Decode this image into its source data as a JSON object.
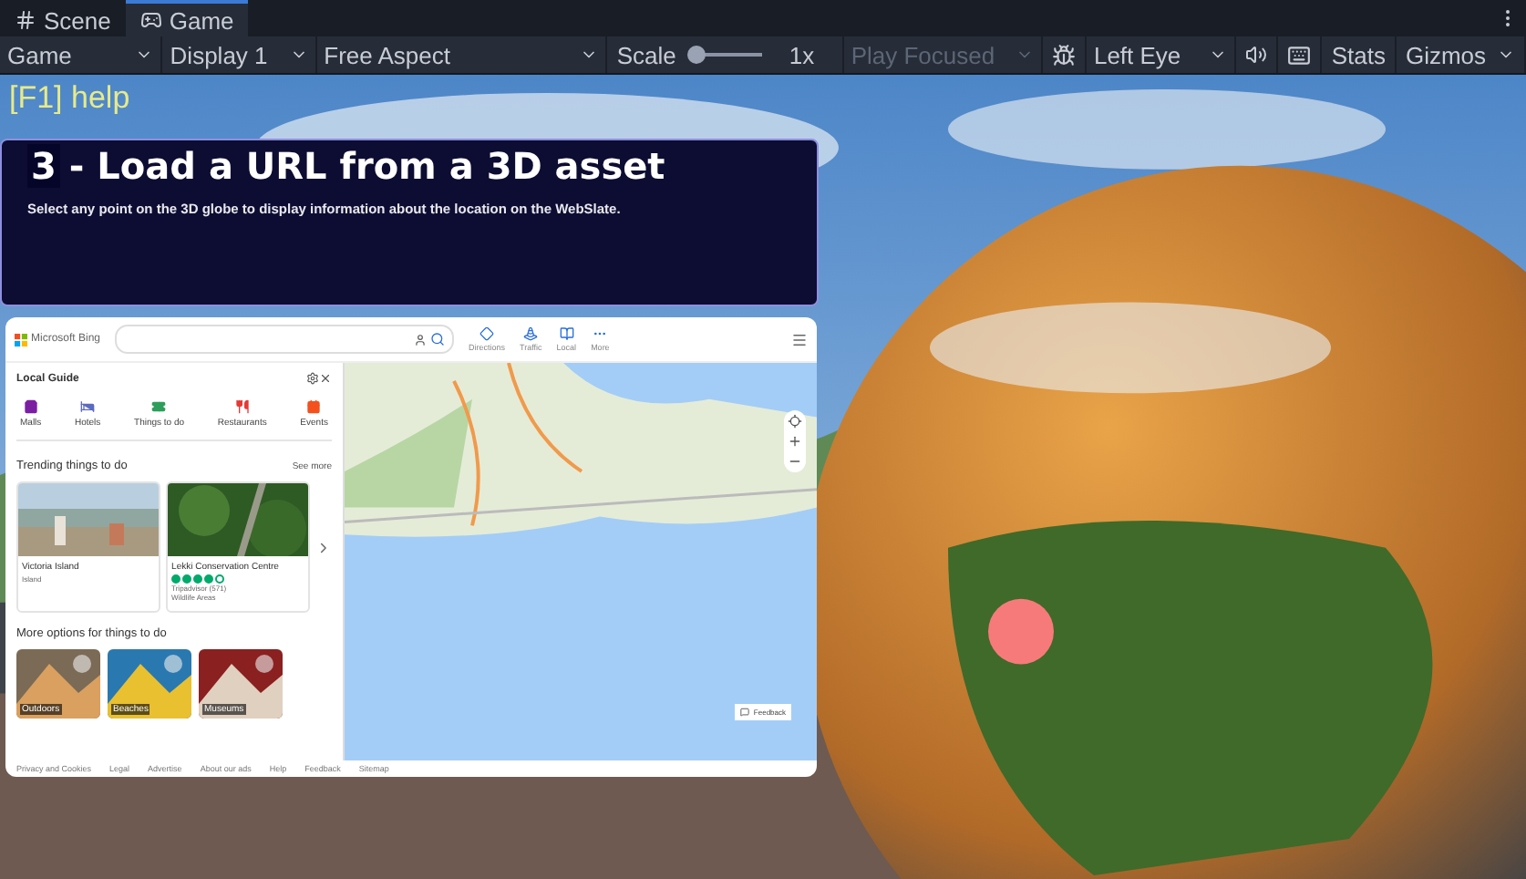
{
  "tabs": [
    {
      "label": "Scene",
      "kind": "grid",
      "selected": false
    },
    {
      "label": "Game",
      "kind": "gamepad",
      "selected": true
    }
  ],
  "toolbar": {
    "view": "Game",
    "display": "Display 1",
    "aspect": "Free Aspect",
    "scale": {
      "label": "Scale",
      "level": 0,
      "reading": "1x"
    },
    "play_mode": {
      "label": "Play Focused",
      "disabled": true
    },
    "eye": "Left Eye",
    "stats": "Stats",
    "gizmos": "Gizmos"
  },
  "game": {
    "help": "[F1] help",
    "panel": {
      "number": "3",
      "title": "- Load a URL from a 3D asset",
      "description": "Select any point on the 3D globe to display information about the location on the WebSlate."
    },
    "slate": {
      "brand": "Microsoft Bing",
      "nav": [
        "Directions",
        "Traffic",
        "Local",
        "More"
      ],
      "guide": {
        "title": "Local Guide",
        "categories": [
          {
            "label": "Malls",
            "color": "#7b1fa2"
          },
          {
            "label": "Hotels",
            "color": "#5c6bc0"
          },
          {
            "label": "Things to do",
            "color": "#2e9e5b"
          },
          {
            "label": "Restaurants",
            "color": "#e53935"
          },
          {
            "label": "Events",
            "color": "#f4511e"
          }
        ],
        "trending": "Trending things to do",
        "see_more": "See more",
        "cards": [
          {
            "title": "Victoria Island",
            "subtitle": "Island"
          },
          {
            "title": "Lekki Conservation Centre",
            "stars": 4,
            "rating": "Tripadvisor (571)",
            "subtitle": "Wildlife Areas"
          }
        ],
        "more": "More options for things to do",
        "tiles": [
          "Outdoors",
          "Beaches",
          "Museums"
        ]
      },
      "footer": [
        "Privacy and Cookies",
        "Legal",
        "Advertise",
        "About our ads",
        "Help",
        "Feedback",
        "Sitemap"
      ],
      "map_feedback": "Feedback"
    }
  }
}
